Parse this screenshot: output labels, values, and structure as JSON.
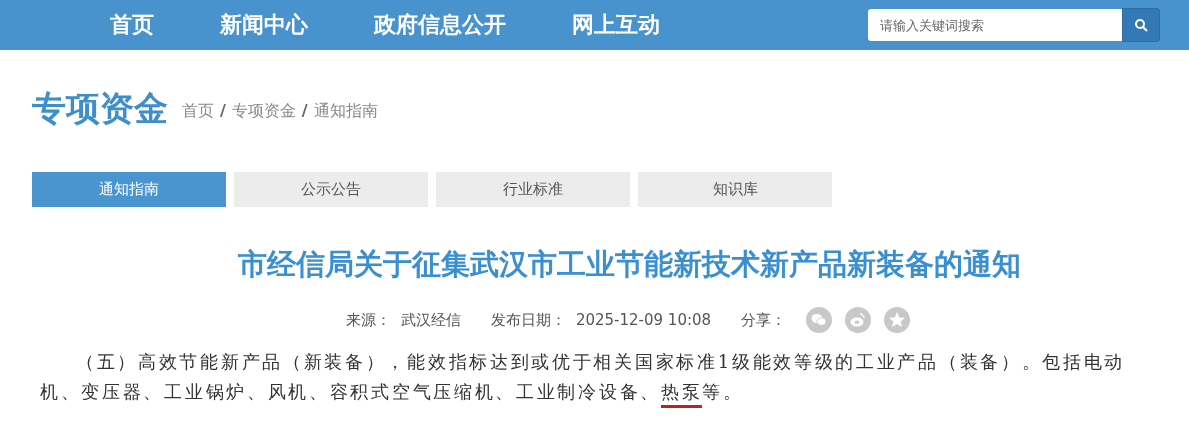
{
  "nav": {
    "items": [
      {
        "label": "首页"
      },
      {
        "label": "新闻中心"
      },
      {
        "label": "政府信息公开"
      },
      {
        "label": "网上互动"
      }
    ],
    "search": {
      "placeholder": "请输入关键词搜索"
    }
  },
  "section": {
    "title": "专项资金",
    "breadcrumb": [
      "首页",
      "专项资金",
      "通知指南"
    ],
    "separator": "/"
  },
  "tabs": [
    {
      "label": "通知指南",
      "selected": true
    },
    {
      "label": "公示公告",
      "selected": false
    },
    {
      "label": "行业标准",
      "selected": false
    },
    {
      "label": "知识库",
      "selected": false
    }
  ],
  "article": {
    "title": "市经信局关于征集武汉市工业节能新技术新产品新装备的通知",
    "source_label": "来源：",
    "source": "武汉经信",
    "date_label": "发布日期：",
    "date": "2025-12-09 10:08",
    "share_label": "分享：",
    "share_icons": [
      {
        "kind": "wechat"
      },
      {
        "kind": "weibo"
      },
      {
        "kind": "qzone"
      }
    ],
    "paragraph": [
      {
        "text": "（五）高效节能新产品（新装备），能效指标达到或优于相关国家标准1级能效等级的工业产品（装备）。包括电动机、变压器、工业锅炉、风机、容积式空气压缩机、工业制冷设备、",
        "underlined": false
      },
      {
        "text": "热泵",
        "underlined": true
      },
      {
        "text": "等。",
        "underlined": false
      }
    ]
  }
}
